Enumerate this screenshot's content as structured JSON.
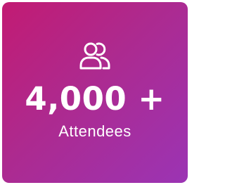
{
  "card": {
    "icon": "users-icon",
    "value": "4,000 +",
    "label": "Attendees",
    "colors": {
      "gradient_start": "#c21b73",
      "gradient_end": "#9b34b4",
      "text": "#ffffff"
    }
  }
}
